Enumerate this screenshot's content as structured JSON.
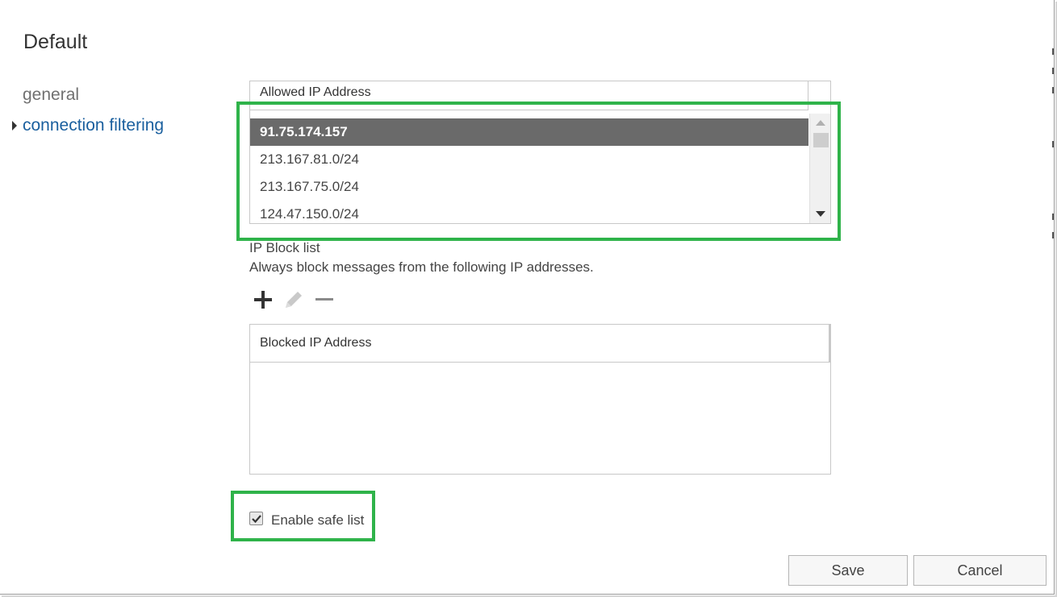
{
  "page": {
    "title": "Default"
  },
  "nav": {
    "items": [
      {
        "label": "general",
        "active": false
      },
      {
        "label": "connection filtering",
        "active": true
      }
    ]
  },
  "allowed_list": {
    "header": "Allowed IP Address",
    "rows": [
      "91.75.174.157",
      "213.167.81.0/24",
      "213.167.75.0/24",
      "124.47.150.0/24"
    ],
    "selected_index": 0
  },
  "block_list": {
    "title": "IP Block list",
    "description": "Always block messages from the following IP addresses.",
    "toolbar": {
      "add_icon": "plus-icon",
      "edit_icon": "pencil-icon",
      "remove_icon": "minus-icon"
    },
    "header": "Blocked IP Address",
    "rows": []
  },
  "safe_list": {
    "label": "Enable safe list",
    "checked": true
  },
  "buttons": {
    "save": "Save",
    "cancel": "Cancel"
  },
  "colors": {
    "highlight": "#2fb34a",
    "link": "#1a5f9e",
    "selected_row": "#6a6a6a"
  }
}
